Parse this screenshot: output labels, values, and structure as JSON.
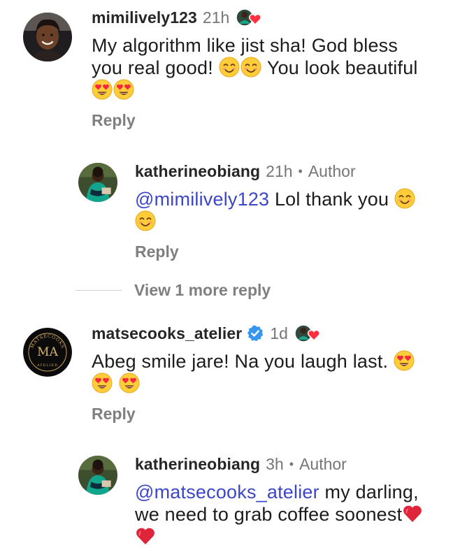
{
  "comments": [
    {
      "username": "mimilively123",
      "time": "21h",
      "text": "My algorithm like jist sha! God bless you real good! ",
      "text_after": " You look beautiful ",
      "reply": "Reply"
    },
    {
      "username": "katherineobiang",
      "time": "21h",
      "author": "Author",
      "mention": "@mimilively123",
      "text": " Lol thank you ",
      "reply": "Reply"
    },
    {
      "username": "matsecooks_atelier",
      "time": "1d",
      "text": "Abeg smile jare! Na you laugh last. ",
      "reply": "Reply",
      "avatar_logo": {
        "top": "MATSECOOKS",
        "initials": "MA",
        "bottom": "ATELIER"
      }
    },
    {
      "username": "katherineobiang",
      "time": "3h",
      "author": "Author",
      "mention": "@matsecooks_atelier",
      "text": " my darling, we need to grab coffee soonest",
      "reply": ""
    }
  ],
  "view_more": "View 1 more reply",
  "colors": {
    "mention": "#3b47c8",
    "meta_gray": "#767676",
    "verified": "#3797f0",
    "heart": "#ff3040"
  },
  "icons": [
    "smiling-face-emoji",
    "heart-eyes-emoji",
    "red-heart-emoji",
    "verified-badge-icon",
    "author-liked-heart-icon"
  ]
}
